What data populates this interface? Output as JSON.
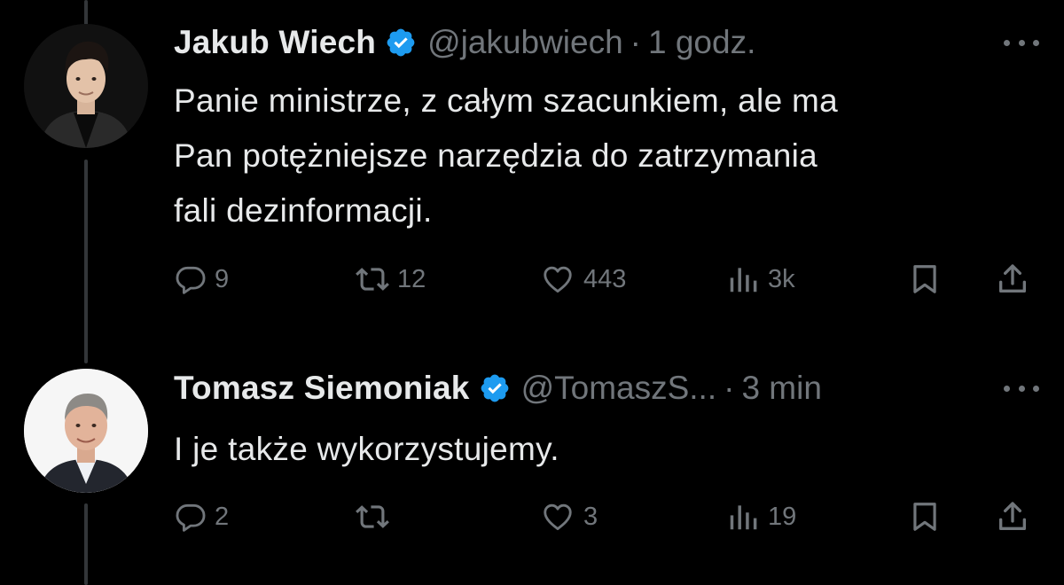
{
  "tweets": [
    {
      "author_name": "Jakub Wiech",
      "handle": "@jakubwiech",
      "separator": "·",
      "time": "1 godz.",
      "text_lines": [
        "Panie ministrze, z całym szacunkiem, ale ma",
        "Pan potężniejsze narzędzia do zatrzymania",
        "fali dezinformacji."
      ],
      "replies": "9",
      "retweets": "12",
      "likes": "443",
      "views": "3k"
    },
    {
      "author_name": "Tomasz Siemoniak",
      "handle": "@TomaszS...",
      "separator": "·",
      "time": "3 min",
      "text_lines": [
        "I je także wykorzystujemy."
      ],
      "replies": "2",
      "retweets": "",
      "likes": "3",
      "views": "19"
    }
  ],
  "icons": {
    "verified": "verified-badge-icon",
    "more": "more-options-icon",
    "reply": "reply-icon",
    "retweet": "retweet-icon",
    "like": "heart-icon",
    "views": "views-chart-icon",
    "bookmark": "bookmark-icon",
    "share": "share-icon"
  },
  "colors": {
    "background": "#000000",
    "text_primary": "#e7e9ea",
    "text_secondary": "#71767b",
    "verified_blue": "#1d9bf0",
    "thread_line": "#333639"
  }
}
